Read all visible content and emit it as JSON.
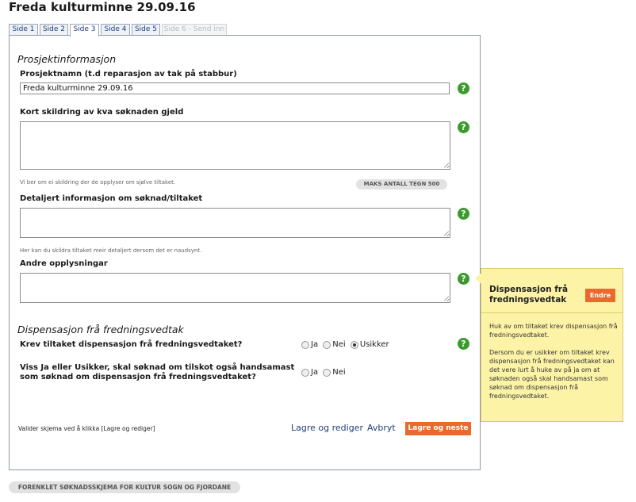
{
  "page": {
    "title": "Freda kulturminne 29.09.16"
  },
  "tabs": [
    {
      "label": "Side 1",
      "state": "normal"
    },
    {
      "label": "Side 2",
      "state": "normal"
    },
    {
      "label": "Side 3",
      "state": "active"
    },
    {
      "label": "Side 4",
      "state": "normal"
    },
    {
      "label": "Side 5",
      "state": "normal"
    },
    {
      "label": "Side 6 - Send inn",
      "state": "disabled"
    }
  ],
  "sections": {
    "project": "Prosjektinformasjon",
    "dispensation": "Dispensasjon frå fredningsvedtak"
  },
  "fields": {
    "project_name": {
      "label": "Prosjektnamn (t.d reparasjon av tak på stabbur)",
      "value": "Freda kulturminne 29.09.16"
    },
    "short_description": {
      "label": "Kort skildring av kva søknaden gjeld",
      "value": "",
      "hint": "Vi ber om ei skildring der de opplyser om sjølve tiltaket.",
      "max_label": "MAKS ANTALL TEGN 500"
    },
    "detailed_info": {
      "label": "Detaljert informasjon om søknad/tiltaket",
      "value": "",
      "hint": "Her kan du skildra tiltaket meir detaljert dersom det er naudsynt."
    },
    "other_info": {
      "label": "Andre opplysningar",
      "value": ""
    }
  },
  "questions": {
    "q1": {
      "text": "Krev tiltaket dispensasjon frå fredningsvedtaket?",
      "options": [
        "Ja",
        "Nei",
        "Usikker"
      ],
      "selected": "Usikker"
    },
    "q2": {
      "text_line1": "Viss Ja eller Usikker, skal søknad om tilskot også handsamast",
      "text_line2": "som søknad om dispensasjon frå fredningsvedtaket?",
      "options": [
        "Ja",
        "Nei"
      ],
      "selected": ""
    }
  },
  "footer": {
    "validate_text": "Valider skjema ved å klikka [Lagre og rediger]",
    "save_edit": "Lagre og rediger",
    "cancel": "Avbryt",
    "save_next": "Lagre og neste",
    "form_name": "FORENKLET SØKNADSSKJEMA FOR KULTUR SOGN OG FJORDANE"
  },
  "help": {
    "glyph": "?"
  },
  "tooltip": {
    "title": "Dispensasjon frå fredningsvedtak",
    "button": "Endre",
    "text1": "Huk av om tiltaket krev dispensasjon frå fredningsvedtaket.",
    "text2": "Dersom du er usikker om tiltaket krev dispensasjon frå fredningsvedtaket kan det vere lurt å huke av på ja om at søknaden også skal handsamast som søknad om dispensasjon frå fredningsvedtaket."
  },
  "colors": {
    "accent_orange": "#ea6a2c",
    "help_green": "#3a9a2c",
    "link_blue": "#1d3f7a",
    "tooltip_yellow": "#fdf3a7"
  }
}
